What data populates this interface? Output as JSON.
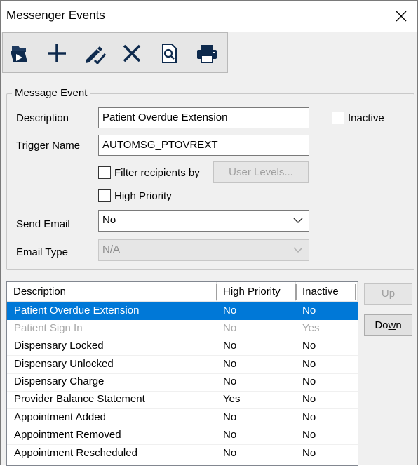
{
  "window": {
    "title": "Messenger Events"
  },
  "toolbar": {
    "buttons": [
      {
        "name": "open-icon"
      },
      {
        "name": "add-icon"
      },
      {
        "name": "edit-icon"
      },
      {
        "name": "delete-icon"
      },
      {
        "name": "preview-icon"
      },
      {
        "name": "print-icon"
      }
    ]
  },
  "message_event": {
    "group_label": "Message Event",
    "description_label": "Description",
    "description_value": "Patient Overdue Extension",
    "inactive_label": "Inactive",
    "trigger_label": "Trigger Name",
    "trigger_value": "AUTOMSG_PTOVREXT",
    "filter_label": "Filter recipients by",
    "user_levels_label": "User Levels...",
    "high_priority_label": "High Priority",
    "send_email_label": "Send Email",
    "send_email_value": "No",
    "email_type_label": "Email Type",
    "email_type_value": "N/A"
  },
  "list": {
    "columns": [
      "Description",
      "High Priority",
      "Inactive"
    ],
    "rows": [
      {
        "description": "Patient Overdue Extension",
        "high_priority": "No",
        "inactive": "No"
      },
      {
        "description": "Patient Sign In",
        "high_priority": "No",
        "inactive": "Yes"
      },
      {
        "description": "Dispensary Locked",
        "high_priority": "No",
        "inactive": "No"
      },
      {
        "description": "Dispensary Unlocked",
        "high_priority": "No",
        "inactive": "No"
      },
      {
        "description": "Dispensary Charge",
        "high_priority": "No",
        "inactive": "No"
      },
      {
        "description": "Provider Balance Statement",
        "high_priority": "Yes",
        "inactive": "No"
      },
      {
        "description": "Appointment Added",
        "high_priority": "No",
        "inactive": "No"
      },
      {
        "description": "Appointment Removed",
        "high_priority": "No",
        "inactive": "No"
      },
      {
        "description": "Appointment Rescheduled",
        "high_priority": "No",
        "inactive": "No"
      }
    ]
  },
  "side_buttons": {
    "up_label": "Up",
    "up_mnemonic": "U",
    "up_rest": "p",
    "down_label": "Down",
    "down_prefix": "Do",
    "down_mnemonic": "w",
    "down_rest": "n"
  },
  "colors": {
    "selection": "#0078d7",
    "disabled_text": "#a8a8a8"
  }
}
